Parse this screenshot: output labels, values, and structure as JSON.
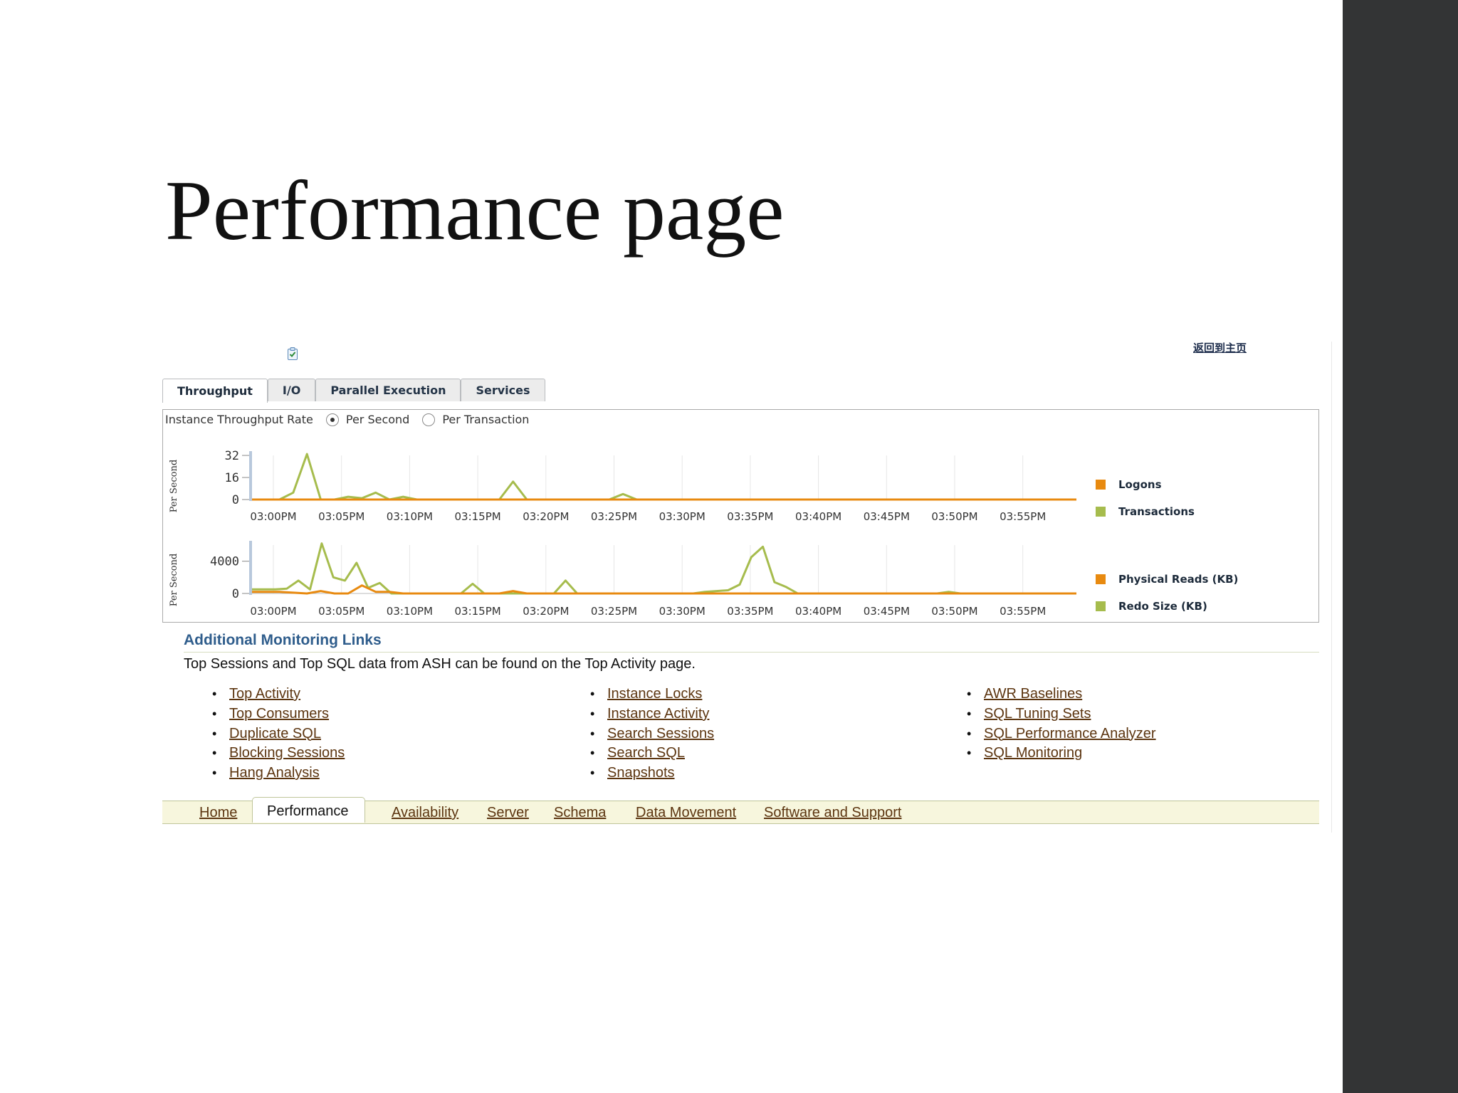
{
  "slide": {
    "title": "Performance page"
  },
  "header": {
    "right_link": "返回到主页"
  },
  "tabs": [
    "Throughput",
    "I/O",
    "Parallel Execution",
    "Services"
  ],
  "active_tab": "Throughput",
  "throughput": {
    "label": "Instance Throughput Rate",
    "options": [
      "Per Second",
      "Per Transaction"
    ],
    "selected": "Per Second"
  },
  "colors": {
    "orange": "#e88a10",
    "green": "#a6bc4d"
  },
  "chart_data": [
    {
      "type": "line",
      "ylabel": "Per Second",
      "yticks": [
        0,
        16,
        32
      ],
      "ylim": [
        0,
        32
      ],
      "x": [
        "03:00PM",
        "03:05PM",
        "03:10PM",
        "03:15PM",
        "03:20PM",
        "03:25PM",
        "03:30PM",
        "03:35PM",
        "03:40PM",
        "03:45PM",
        "03:50PM",
        "03:55PM"
      ],
      "legend_position": "right",
      "series": [
        {
          "name": "Logons",
          "color": "#e88a10",
          "values": [
            0,
            0,
            0,
            0,
            0,
            0,
            0,
            0,
            0,
            0,
            0,
            0,
            0,
            0,
            0,
            0,
            0,
            0,
            0,
            0,
            0,
            0,
            0,
            0,
            0,
            0,
            0,
            0,
            0,
            0,
            0,
            0,
            0,
            0,
            0,
            0,
            0,
            0,
            0,
            0,
            0,
            0,
            0,
            0,
            0,
            0,
            0,
            0,
            0,
            0,
            0,
            0,
            0,
            0,
            0,
            0,
            0,
            0,
            0,
            0,
            0
          ]
        },
        {
          "name": "Transactions",
          "color": "#a6bc4d",
          "values": [
            0,
            0,
            0,
            5,
            33,
            0,
            0,
            2,
            1,
            5,
            0,
            2,
            0,
            0,
            0,
            0,
            0,
            0,
            0,
            13,
            0,
            0,
            0,
            0,
            0,
            0,
            0,
            4,
            0,
            0,
            0,
            0,
            0,
            0,
            0,
            0,
            0,
            0,
            0,
            0,
            0,
            0,
            0,
            0,
            0,
            0,
            0,
            0,
            0,
            0,
            0,
            0,
            0,
            0,
            0,
            0,
            0,
            0,
            0,
            0,
            0
          ],
          "values_note": ""
        }
      ]
    },
    {
      "type": "line",
      "ylabel": "Per Second",
      "yticks": [
        0,
        4000
      ],
      "ylim": [
        0,
        6000
      ],
      "x": [
        "03:00PM",
        "03:05PM",
        "03:10PM",
        "03:15PM",
        "03:20PM",
        "03:25PM",
        "03:30PM",
        "03:35PM",
        "03:40PM",
        "03:45PM",
        "03:50PM",
        "03:55PM"
      ],
      "legend_position": "right",
      "series": [
        {
          "name": "Physical Reads (KB)",
          "color": "#e88a10",
          "values": [
            200,
            200,
            200,
            100,
            0,
            300,
            0,
            0,
            1000,
            200,
            200,
            0,
            0,
            0,
            0,
            0,
            0,
            0,
            0,
            300,
            0,
            0,
            0,
            0,
            0,
            0,
            0,
            0,
            0,
            0,
            0,
            0,
            0,
            0,
            0,
            0,
            0,
            0,
            0,
            0,
            0,
            0,
            0,
            0,
            0,
            0,
            0,
            0,
            0,
            0,
            0,
            0,
            0,
            0,
            0,
            0,
            0,
            0,
            0,
            0,
            0
          ]
        },
        {
          "name": "Redo Size (KB)",
          "color": "#a6bc4d",
          "values": [
            500,
            500,
            500,
            600,
            1600,
            500,
            6200,
            2000,
            1600,
            3800,
            700,
            1300,
            0,
            0,
            0,
            0,
            0,
            0,
            0,
            1200,
            0,
            0,
            0,
            0,
            0,
            0,
            0,
            1600,
            0,
            0,
            0,
            0,
            0,
            0,
            0,
            0,
            0,
            0,
            0,
            200,
            300,
            400,
            1100,
            4500,
            5800,
            1400,
            800,
            0,
            0,
            0,
            0,
            0,
            0,
            0,
            0,
            0,
            0,
            0,
            0,
            0,
            200,
            0,
            0,
            0,
            0,
            0,
            0,
            0,
            0,
            0,
            0,
            0
          ]
        }
      ]
    }
  ],
  "monitoring": {
    "title": "Additional Monitoring Links",
    "desc": "Top Sessions and Top SQL data from ASH can be found on the Top Activity page.",
    "col1": [
      "Top Activity",
      "Top Consumers",
      "Duplicate SQL",
      "Blocking Sessions",
      "Hang Analysis"
    ],
    "col2": [
      "Instance Locks",
      "Instance Activity",
      "Search Sessions",
      "Search SQL",
      "Snapshots"
    ],
    "col3": [
      "AWR Baselines",
      "SQL Tuning Sets",
      "SQL Performance Analyzer",
      "SQL Monitoring"
    ]
  },
  "bottom_tabs": [
    "Home",
    "Performance",
    "Availability",
    "Server",
    "Schema",
    "Data Movement",
    "Software and Support"
  ],
  "bottom_active": "Performance"
}
